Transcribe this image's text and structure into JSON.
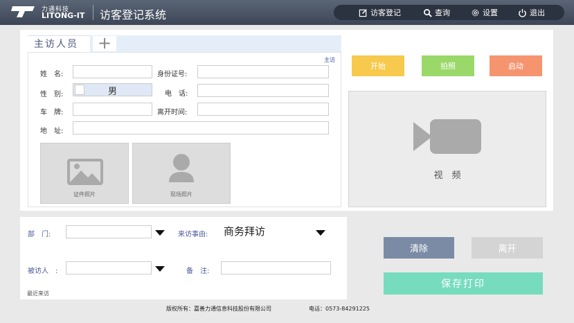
{
  "brand": {
    "name_cn": "力通科技",
    "name_en": "LITONG-IT",
    "app_title": "访客登记系统"
  },
  "nav": [
    {
      "label": "访客登记",
      "icon": "edit-icon"
    },
    {
      "label": "查询",
      "icon": "search-icon"
    },
    {
      "label": "设置",
      "icon": "gear-icon"
    },
    {
      "label": "退出",
      "icon": "power-icon"
    }
  ],
  "host_section": {
    "tab_label": "主访人员",
    "add_tab": "+",
    "corner_tag": "主访"
  },
  "form": {
    "name_label": "姓　名:",
    "name_value": "",
    "id_label": "身份证号:",
    "id_value": "",
    "gender_label": "性　别:",
    "gender_value": "男",
    "phone_label": "电　话:",
    "phone_value": "",
    "plate_label": "车　牌:",
    "plate_value": "",
    "leave_label": "离开时间:",
    "leave_value": "",
    "address_label": "地　址:",
    "address_value": ""
  },
  "photos": {
    "id_photo": "证件照片",
    "scene_photo": "现场照片"
  },
  "camera": {
    "start": "开始",
    "capture": "拍照",
    "launch": "启动",
    "video_label": "视　频"
  },
  "visit": {
    "dept_label": "部　门:",
    "dept_value": "",
    "reason_label": "来访事由:",
    "reason_value": "商务拜访",
    "visitee_label": "被访人　:",
    "visitee_value": "",
    "note_label": "备　注:",
    "note_value": "",
    "recent": "最近来访"
  },
  "actions": {
    "clear": "清除",
    "leave": "离开",
    "save_print": "保存打印"
  },
  "footer": {
    "copyright": "版权所有：嘉善力通信息科技股份有限公司",
    "phone": "电话：0573-84291225"
  },
  "colors": {
    "start": "#f7c94c",
    "capture": "#9ad86a",
    "launch": "#f5946e",
    "clear": "#7b8ba6",
    "leave": "#d4d4d4",
    "save": "#77dcbe"
  }
}
